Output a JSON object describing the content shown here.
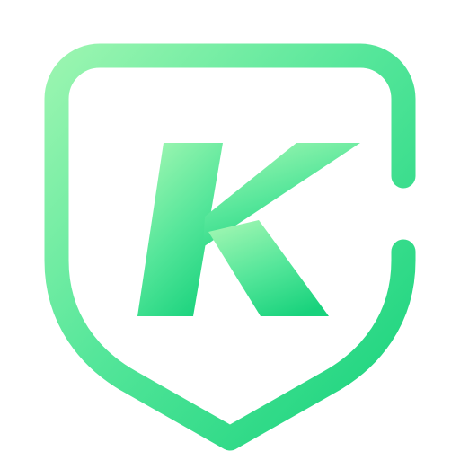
{
  "logo": {
    "icon_name": "shield-k-logo-icon",
    "letter": "K",
    "colors": {
      "gradient_light": "#9af5b0",
      "gradient_mid": "#55e69a",
      "gradient_dark": "#18d27c",
      "background": "#ffffff"
    }
  }
}
